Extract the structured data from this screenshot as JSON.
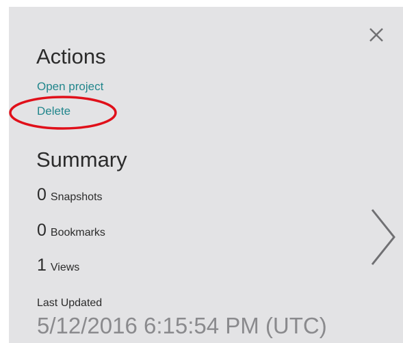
{
  "panel": {
    "background": "#e3e3e5",
    "close_icon": "close-x-icon",
    "next_icon": "chevron-right-icon"
  },
  "actions": {
    "title": "Actions",
    "links": [
      {
        "label": "Open project"
      },
      {
        "label": "Delete"
      }
    ],
    "link_color": "#22868c",
    "highlight_color": "#e0101a"
  },
  "summary": {
    "title": "Summary",
    "stats": [
      {
        "count": "0",
        "label": "Snapshots"
      },
      {
        "count": "0",
        "label": "Bookmarks"
      },
      {
        "count": "1",
        "label": "Views"
      }
    ]
  },
  "last_updated": {
    "label": "Last Updated",
    "value": "5/12/2016 6:15:54 PM (UTC)"
  }
}
